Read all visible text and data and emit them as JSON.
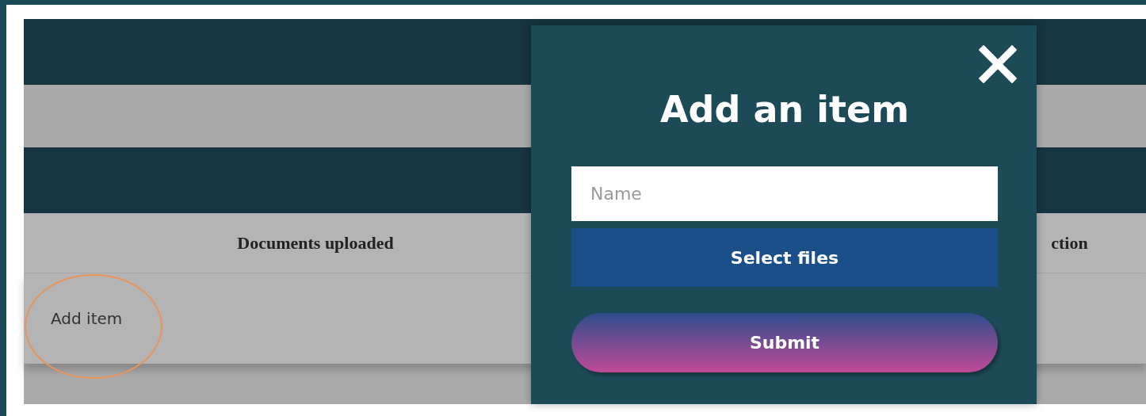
{
  "table": {
    "columns": [
      "Documents uploaded",
      "ction"
    ],
    "rows": [
      {
        "add_link": "Add item"
      }
    ]
  },
  "modal": {
    "title": "Add an item",
    "name_field": {
      "placeholder": "Name"
    },
    "select_button": "Select files",
    "submit_button": "Submit"
  }
}
